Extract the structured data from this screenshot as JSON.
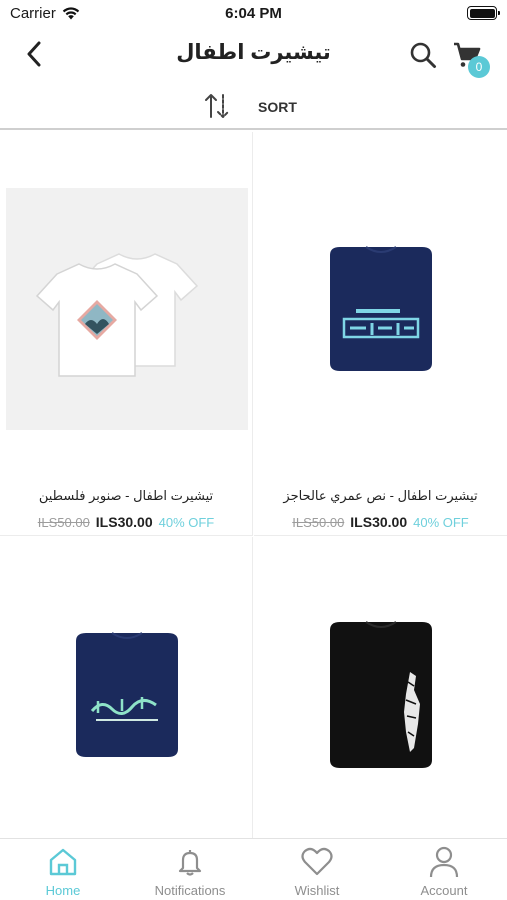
{
  "status_bar": {
    "carrier": "Carrier",
    "time": "6:04 PM"
  },
  "nav": {
    "title": "تيشيرت اطفال",
    "cart_count": "0"
  },
  "sort": {
    "label": "SORT"
  },
  "products": [
    {
      "name": "تيشيرت اطفال - صنوبر فلسطين",
      "old_price": "ILS50.00",
      "new_price": "ILS30.00",
      "discount": "40% OFF"
    },
    {
      "name": "تيشيرت اطفال - نص عمري عالحاجز",
      "old_price": "ILS50.00",
      "new_price": "ILS30.00",
      "discount": "40% OFF"
    },
    {
      "name": "",
      "old_price": "",
      "new_price": "",
      "discount": ""
    },
    {
      "name": "",
      "old_price": "",
      "new_price": "",
      "discount": ""
    }
  ],
  "tab_bar": {
    "items": [
      {
        "label": "Home",
        "icon": "home-icon",
        "active": true
      },
      {
        "label": "Notifications",
        "icon": "bell-icon",
        "active": false
      },
      {
        "label": "Wishlist",
        "icon": "heart-icon",
        "active": false
      },
      {
        "label": "Account",
        "icon": "user-icon",
        "active": false
      }
    ]
  },
  "colors": {
    "accent": "#5bc9d6",
    "discount": "#6fd0dc",
    "navy_shirt": "#1b2a5c",
    "black_shirt": "#111111"
  }
}
